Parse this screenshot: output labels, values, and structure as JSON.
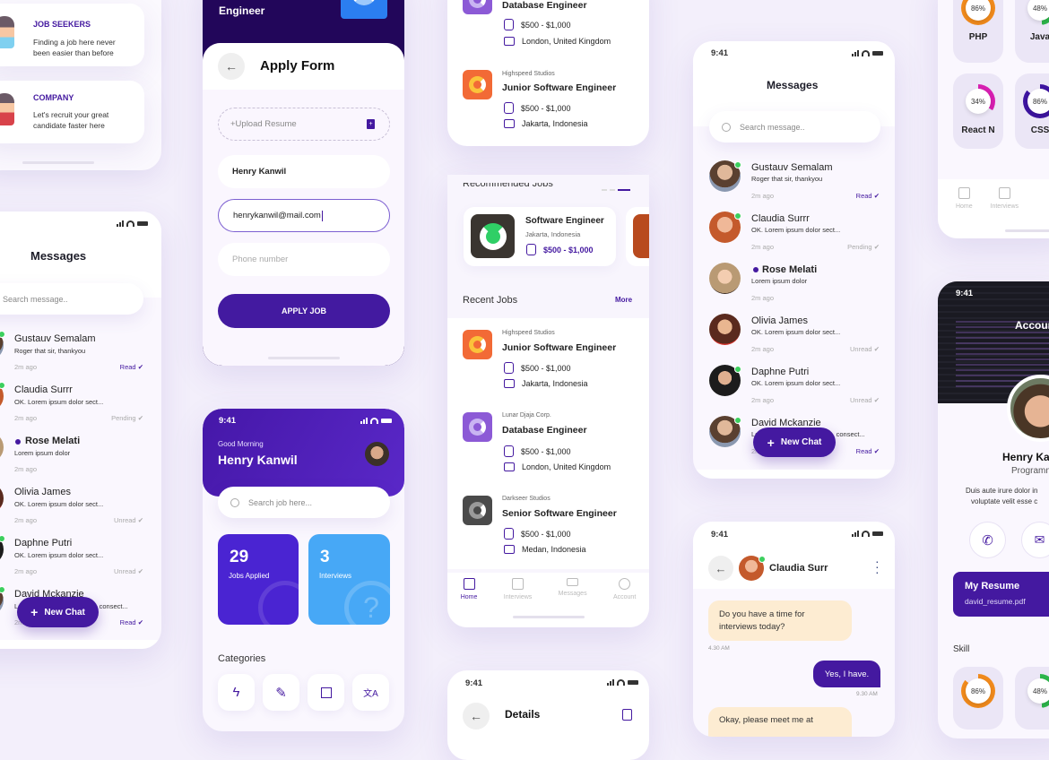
{
  "status_time": "9:41",
  "onboarding": {
    "options": [
      {
        "title": "JOB SEEKERS",
        "desc_1": "Finding a job here never",
        "desc_2": "been easier than before"
      },
      {
        "title": "COMPANY",
        "desc_1": "Let's recruit your great",
        "desc_2": "candidate faster here"
      }
    ]
  },
  "apply_form": {
    "header_title": "Engineer",
    "title": "Apply Form",
    "upload_placeholder": "+Upload Resume",
    "name_value": "Henry Kanwil",
    "email_value": "henrykanwil@mail.com",
    "phone_placeholder": "Phone number",
    "submit_label": "APPLY JOB"
  },
  "messages": {
    "title": "Messages",
    "search_placeholder": "Search message..",
    "new_chat_label": "New Chat",
    "items": [
      {
        "name": "Gustauv Semalam",
        "text": "Roger that sir, thankyou",
        "time": "2m ago",
        "status": "Read",
        "online": true
      },
      {
        "name": "Claudia Surrr",
        "text": "OK. Lorem ipsum dolor sect...",
        "time": "2m ago",
        "status": "Pending",
        "online": true
      },
      {
        "name": "Rose Melati",
        "text": "Lorem ipsum dolor",
        "time": "2m ago",
        "status": "",
        "online": false,
        "unread_dot": true
      },
      {
        "name": "Olivia James",
        "text": "OK. Lorem ipsum dolor sect...",
        "time": "2m ago",
        "status": "Unread",
        "online": false
      },
      {
        "name": "Daphne Putri",
        "text": "OK. Lorem ipsum dolor sect...",
        "time": "2m ago",
        "status": "Unread",
        "online": true
      },
      {
        "name": "David Mckanzie",
        "text": "Lorem ipsum dolor sit amet, consect...",
        "time": "2m ago",
        "status": "Read",
        "online": true
      }
    ]
  },
  "home": {
    "greeting": "Good Morning",
    "user_name": "Henry Kanwil",
    "search_placeholder": "Search job here...",
    "stats": [
      {
        "value": "29",
        "label": "Jobs Applied"
      },
      {
        "value": "3",
        "label": "Interviews"
      }
    ],
    "categories_title": "Categories",
    "categories": [
      "lightning-icon",
      "pen-icon",
      "vector-icon",
      "translate-icon"
    ]
  },
  "jobs": {
    "top_list": [
      {
        "company": "Lunar Djaja Corp.",
        "title": "Database Engineer",
        "salary": "$500 - $1,000",
        "location": "London, United Kingdom",
        "color": "#8c5ad6",
        "ring": "#c9b4f2"
      },
      {
        "company": "Highspeed Studios",
        "title": "Junior Software Engineer",
        "salary": "$500 - $1,000",
        "location": "Jakarta, Indonesia",
        "color": "#f26a36",
        "ring": "#fbc33a"
      }
    ],
    "recommended_title": "Recommended Jobs",
    "recommended": [
      {
        "title": "Software Engineer",
        "location": "Jakarta, Indonesia",
        "salary": "$500 - $1,000"
      }
    ],
    "recent_title": "Recent Jobs",
    "more_label": "More",
    "recent": [
      {
        "company": "Highspeed Studios",
        "title": "Junior Software Engineer",
        "salary": "$500 - $1,000",
        "location": "Jakarta, Indonesia",
        "color": "#f26a36",
        "ring": "#fbc33a"
      },
      {
        "company": "Lunar Djaja Corp.",
        "title": "Database Engineer",
        "salary": "$500 - $1,000",
        "location": "London, United Kingdom",
        "color": "#8c5ad6",
        "ring": "#c9b4f2"
      },
      {
        "company": "Darkseer Studios",
        "title": "Senior Software Engineer",
        "salary": "$500 - $1,000",
        "location": "Medan, Indonesia",
        "color": "#4a4a4a",
        "ring": "#9a9a9a"
      }
    ],
    "nav": [
      "Home",
      "Interviews",
      "Messages",
      "Account"
    ],
    "details_title": "Details"
  },
  "chat": {
    "contact_name": "Claudia Surr",
    "messages": [
      {
        "text_1": "Do you have a time for",
        "text_2": "interviews today?",
        "time": "4.30 AM",
        "from": "them"
      },
      {
        "text_1": "Yes, I have.",
        "time": "9.30 AM",
        "from": "me"
      },
      {
        "text_1": "Okay, please meet me at",
        "from": "them"
      }
    ]
  },
  "account": {
    "title": "Account",
    "name": "Henry Kanwil",
    "role": "Programmer",
    "bio_1": "Duis aute irure dolor in",
    "bio_2": "voluptate velit esse c",
    "resume_title": "My Resume",
    "resume_file": "david_resume.pdf",
    "skill_title": "Skill",
    "skills_top": [
      {
        "name": "PHP",
        "percent": 86,
        "color": "#f08a1c"
      },
      {
        "name": "Java",
        "percent": 48,
        "color": "#2cb54a"
      },
      {
        "name": "React N",
        "percent": 34,
        "color": "#d61fb0"
      },
      {
        "name": "CSS",
        "percent": 86,
        "color": "#3d14a0"
      }
    ],
    "skills_bottom": [
      {
        "name": "PHP",
        "percent": 86,
        "color": "#f08a1c"
      },
      {
        "name": "Java",
        "percent": 48,
        "color": "#2cb54a"
      }
    ],
    "nav": [
      "Home",
      "Interviews"
    ]
  }
}
